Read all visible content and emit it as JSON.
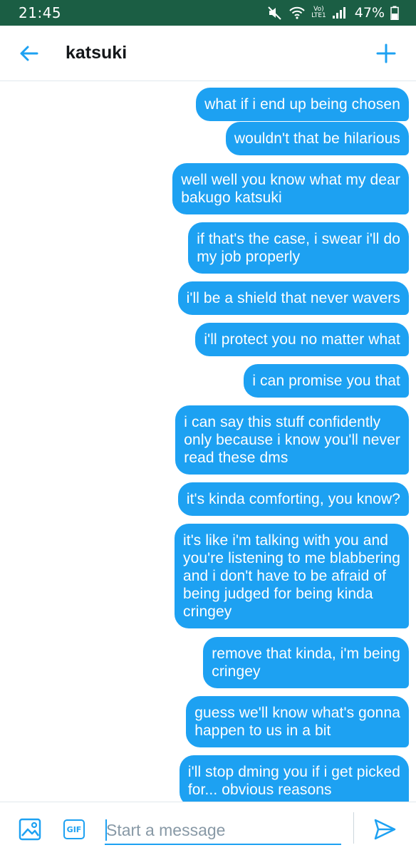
{
  "status_bar": {
    "time": "21:45",
    "lte_top": "Vo)",
    "lte_bottom": "LTE1",
    "battery": "47%"
  },
  "header": {
    "title": "katsuki",
    "back_icon": "arrow-left-icon",
    "new_icon": "plus-icon"
  },
  "messages": [
    {
      "text": "what if i end up being chosen"
    },
    {
      "text": "wouldn't that be hilarious"
    },
    {
      "text": "well well you know what my dear\nbakugo katsuki"
    },
    {
      "text": "if that's the case, i swear i'll do\nmy job properly"
    },
    {
      "text": "i'll be a shield that never wavers"
    },
    {
      "text": "i'll protect you no matter what"
    },
    {
      "text": "i can promise you that"
    },
    {
      "text": "i can say this stuff confidently\nonly because i know you'll never\nread these dms"
    },
    {
      "text": "it's kinda comforting, you know?"
    },
    {
      "text": "it's like i'm talking with you and\nyou're listening to me blabbering\nand i don't have to be afraid of\nbeing judged for being kinda\ncringey"
    },
    {
      "text": "remove that kinda, i'm being\ncringey"
    },
    {
      "text": "guess we'll know what's gonna\nhappen to us in a bit"
    },
    {
      "text": "i'll stop dming you if i get picked\nfor... obvious reasons"
    }
  ],
  "compose": {
    "placeholder": "Start a message",
    "gif_label": "GIF",
    "image_icon": "image-icon",
    "send_icon": "send-icon"
  },
  "colors": {
    "accent": "#1da1f2",
    "status_bar": "#1b5e44",
    "bubble_text": "#ffffff",
    "title_text": "#14171a",
    "placeholder": "#8899a6"
  }
}
